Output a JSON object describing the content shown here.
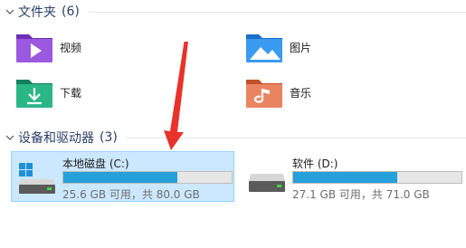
{
  "folders_group": {
    "title": "文件夹",
    "count": "(6)",
    "items": [
      {
        "label": "视频",
        "icon": "videos-folder-icon"
      },
      {
        "label": "图片",
        "icon": "pictures-folder-icon"
      },
      {
        "label": "下载",
        "icon": "downloads-folder-icon"
      },
      {
        "label": "音乐",
        "icon": "music-folder-icon"
      }
    ]
  },
  "drives_group": {
    "title": "设备和驱动器",
    "count": "(3)",
    "drives": [
      {
        "name": "本地磁盘 (C:)",
        "free_text": "25.6 GB 可用，共 80.0 GB",
        "used_fraction": 0.68,
        "selected": true,
        "icon": "windows-drive-icon"
      },
      {
        "name": "软件 (D:)",
        "free_text": "27.1 GB 可用，共 71.0 GB",
        "used_fraction": 0.62,
        "selected": false,
        "icon": "drive-icon"
      }
    ]
  },
  "colors": {
    "accent": "#26a0da",
    "selection_bg": "#cce8ff",
    "annotation_arrow": "#e8322a"
  }
}
